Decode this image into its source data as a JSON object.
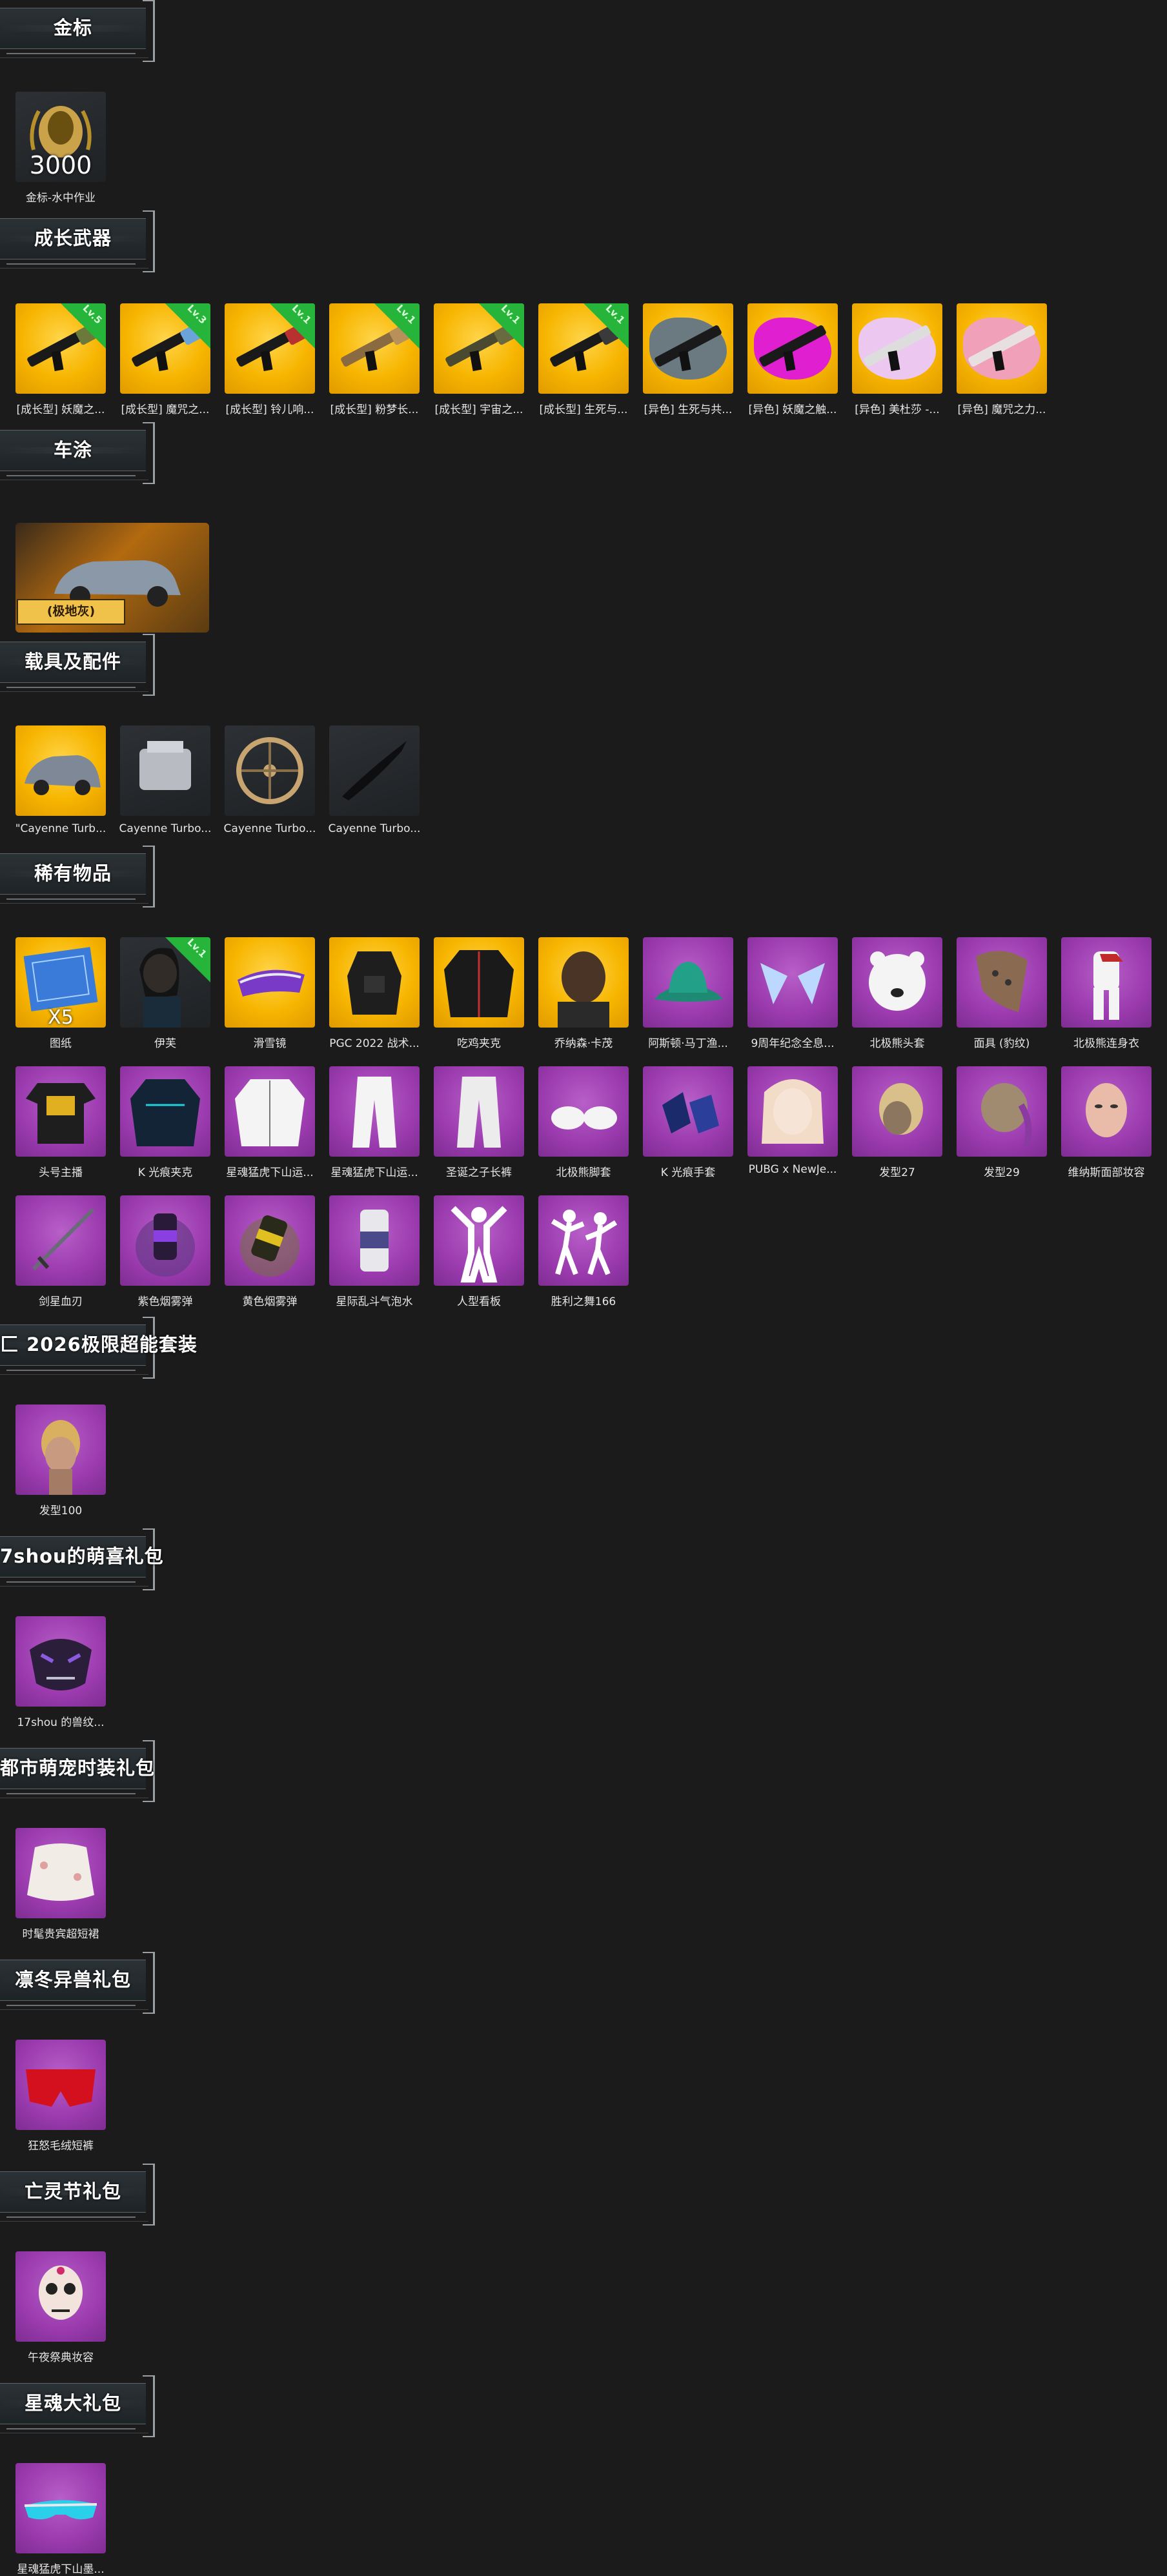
{
  "sections": [
    {
      "id": "gold",
      "title": "金标",
      "items": [
        {
          "label": "金标-水中作业",
          "value": "3000"
        }
      ]
    },
    {
      "id": "weapons",
      "title": "成长武器",
      "items": [
        {
          "label": "[成长型] 妖魔之...",
          "level": "Lv.5",
          "color": "#6b7a3a"
        },
        {
          "label": "[成长型] 魔咒之...",
          "level": "Lv.3",
          "color": "#6aa4d8"
        },
        {
          "label": "[成长型] 铃儿响...",
          "level": "Lv.1",
          "color": "#b83030"
        },
        {
          "label": "[成长型] 粉梦长...",
          "level": "Lv.1",
          "color": "#b8905a"
        },
        {
          "label": "[成长型] 宇宙之...",
          "level": "Lv.1",
          "color": "#6a6a40"
        },
        {
          "label": "[成长型] 生死与...",
          "level": "Lv.1",
          "color": "#3a3a3a"
        },
        {
          "label": "[异色] 生死与共...",
          "splash": "#6a7a80"
        },
        {
          "label": "[异色] 妖魔之触...",
          "splash": "#e020d0"
        },
        {
          "label": "[异色] 美杜莎 -...",
          "splash": "#ecc8f0"
        },
        {
          "label": "[异色] 魔咒之力...",
          "splash": "#f0a0b8"
        }
      ]
    },
    {
      "id": "vehicle-trail",
      "title": "车涂",
      "items": [
        {
          "label": "(极地灰)"
        }
      ]
    },
    {
      "id": "vehicle-parts",
      "title": "载具及配件",
      "items": [
        {
          "label": "\"Cayenne Turb..."
        },
        {
          "label": "Cayenne Turbo..."
        },
        {
          "label": "Cayenne Turbo..."
        },
        {
          "label": "Cayenne Turbo..."
        }
      ]
    },
    {
      "id": "rare",
      "title": "稀有物品",
      "items": [
        {
          "label": "图纸",
          "qty": "X5"
        },
        {
          "label": "伊芙",
          "level": "Lv.1"
        },
        {
          "label": "滑雪镜"
        },
        {
          "label": "PGC 2022 战术..."
        },
        {
          "label": "吃鸡夹克"
        },
        {
          "label": "乔纳森·卡茂"
        },
        {
          "label": "阿斯顿·马丁渔..."
        },
        {
          "label": "9周年纪念全息..."
        },
        {
          "label": "北极熊头套"
        },
        {
          "label": "面具 (豹纹)"
        },
        {
          "label": "北极熊连身衣"
        },
        {
          "label": "头号主播"
        },
        {
          "label": "K 光痕夹克"
        },
        {
          "label": "星魂猛虎下山运..."
        },
        {
          "label": "星魂猛虎下山运..."
        },
        {
          "label": "圣诞之子长裤"
        },
        {
          "label": "北极熊脚套"
        },
        {
          "label": "K 光痕手套"
        },
        {
          "label": "PUBG x NewJe..."
        },
        {
          "label": "发型27"
        },
        {
          "label": "发型29"
        },
        {
          "label": "维纳斯面部妆容"
        },
        {
          "label": "剑星血刃"
        },
        {
          "label": "紫色烟雾弹"
        },
        {
          "label": "黄色烟雾弹"
        },
        {
          "label": "星际乱斗气泡水"
        },
        {
          "label": "人型看板"
        },
        {
          "label": "胜利之舞166"
        }
      ]
    },
    {
      "id": "pack1",
      "title": "2026极限超能套装",
      "title_prefix": "匚",
      "items": [
        {
          "label": "发型100"
        }
      ]
    },
    {
      "id": "pack2",
      "title": "7shou的萌喜礼包",
      "items": [
        {
          "label": "17shou 的兽纹..."
        }
      ]
    },
    {
      "id": "pack3",
      "title": "都市萌宠时装礼包",
      "items": [
        {
          "label": "时髦贵宾超短裙"
        }
      ]
    },
    {
      "id": "pack4",
      "title": "凛冬异兽礼包",
      "items": [
        {
          "label": "狂怒毛绒短裤"
        }
      ]
    },
    {
      "id": "pack5",
      "title": "亡灵节礼包",
      "items": [
        {
          "label": "午夜祭典妆容"
        }
      ]
    },
    {
      "id": "pack6",
      "title": "星魂大礼包",
      "items": [
        {
          "label": "星魂猛虎下山墨..."
        }
      ]
    }
  ],
  "colors": {
    "background": "#1b1b1c",
    "gold_tile": "#f7b500",
    "purple_tile": "#9a3aae",
    "level_badge": "#27b43a"
  }
}
